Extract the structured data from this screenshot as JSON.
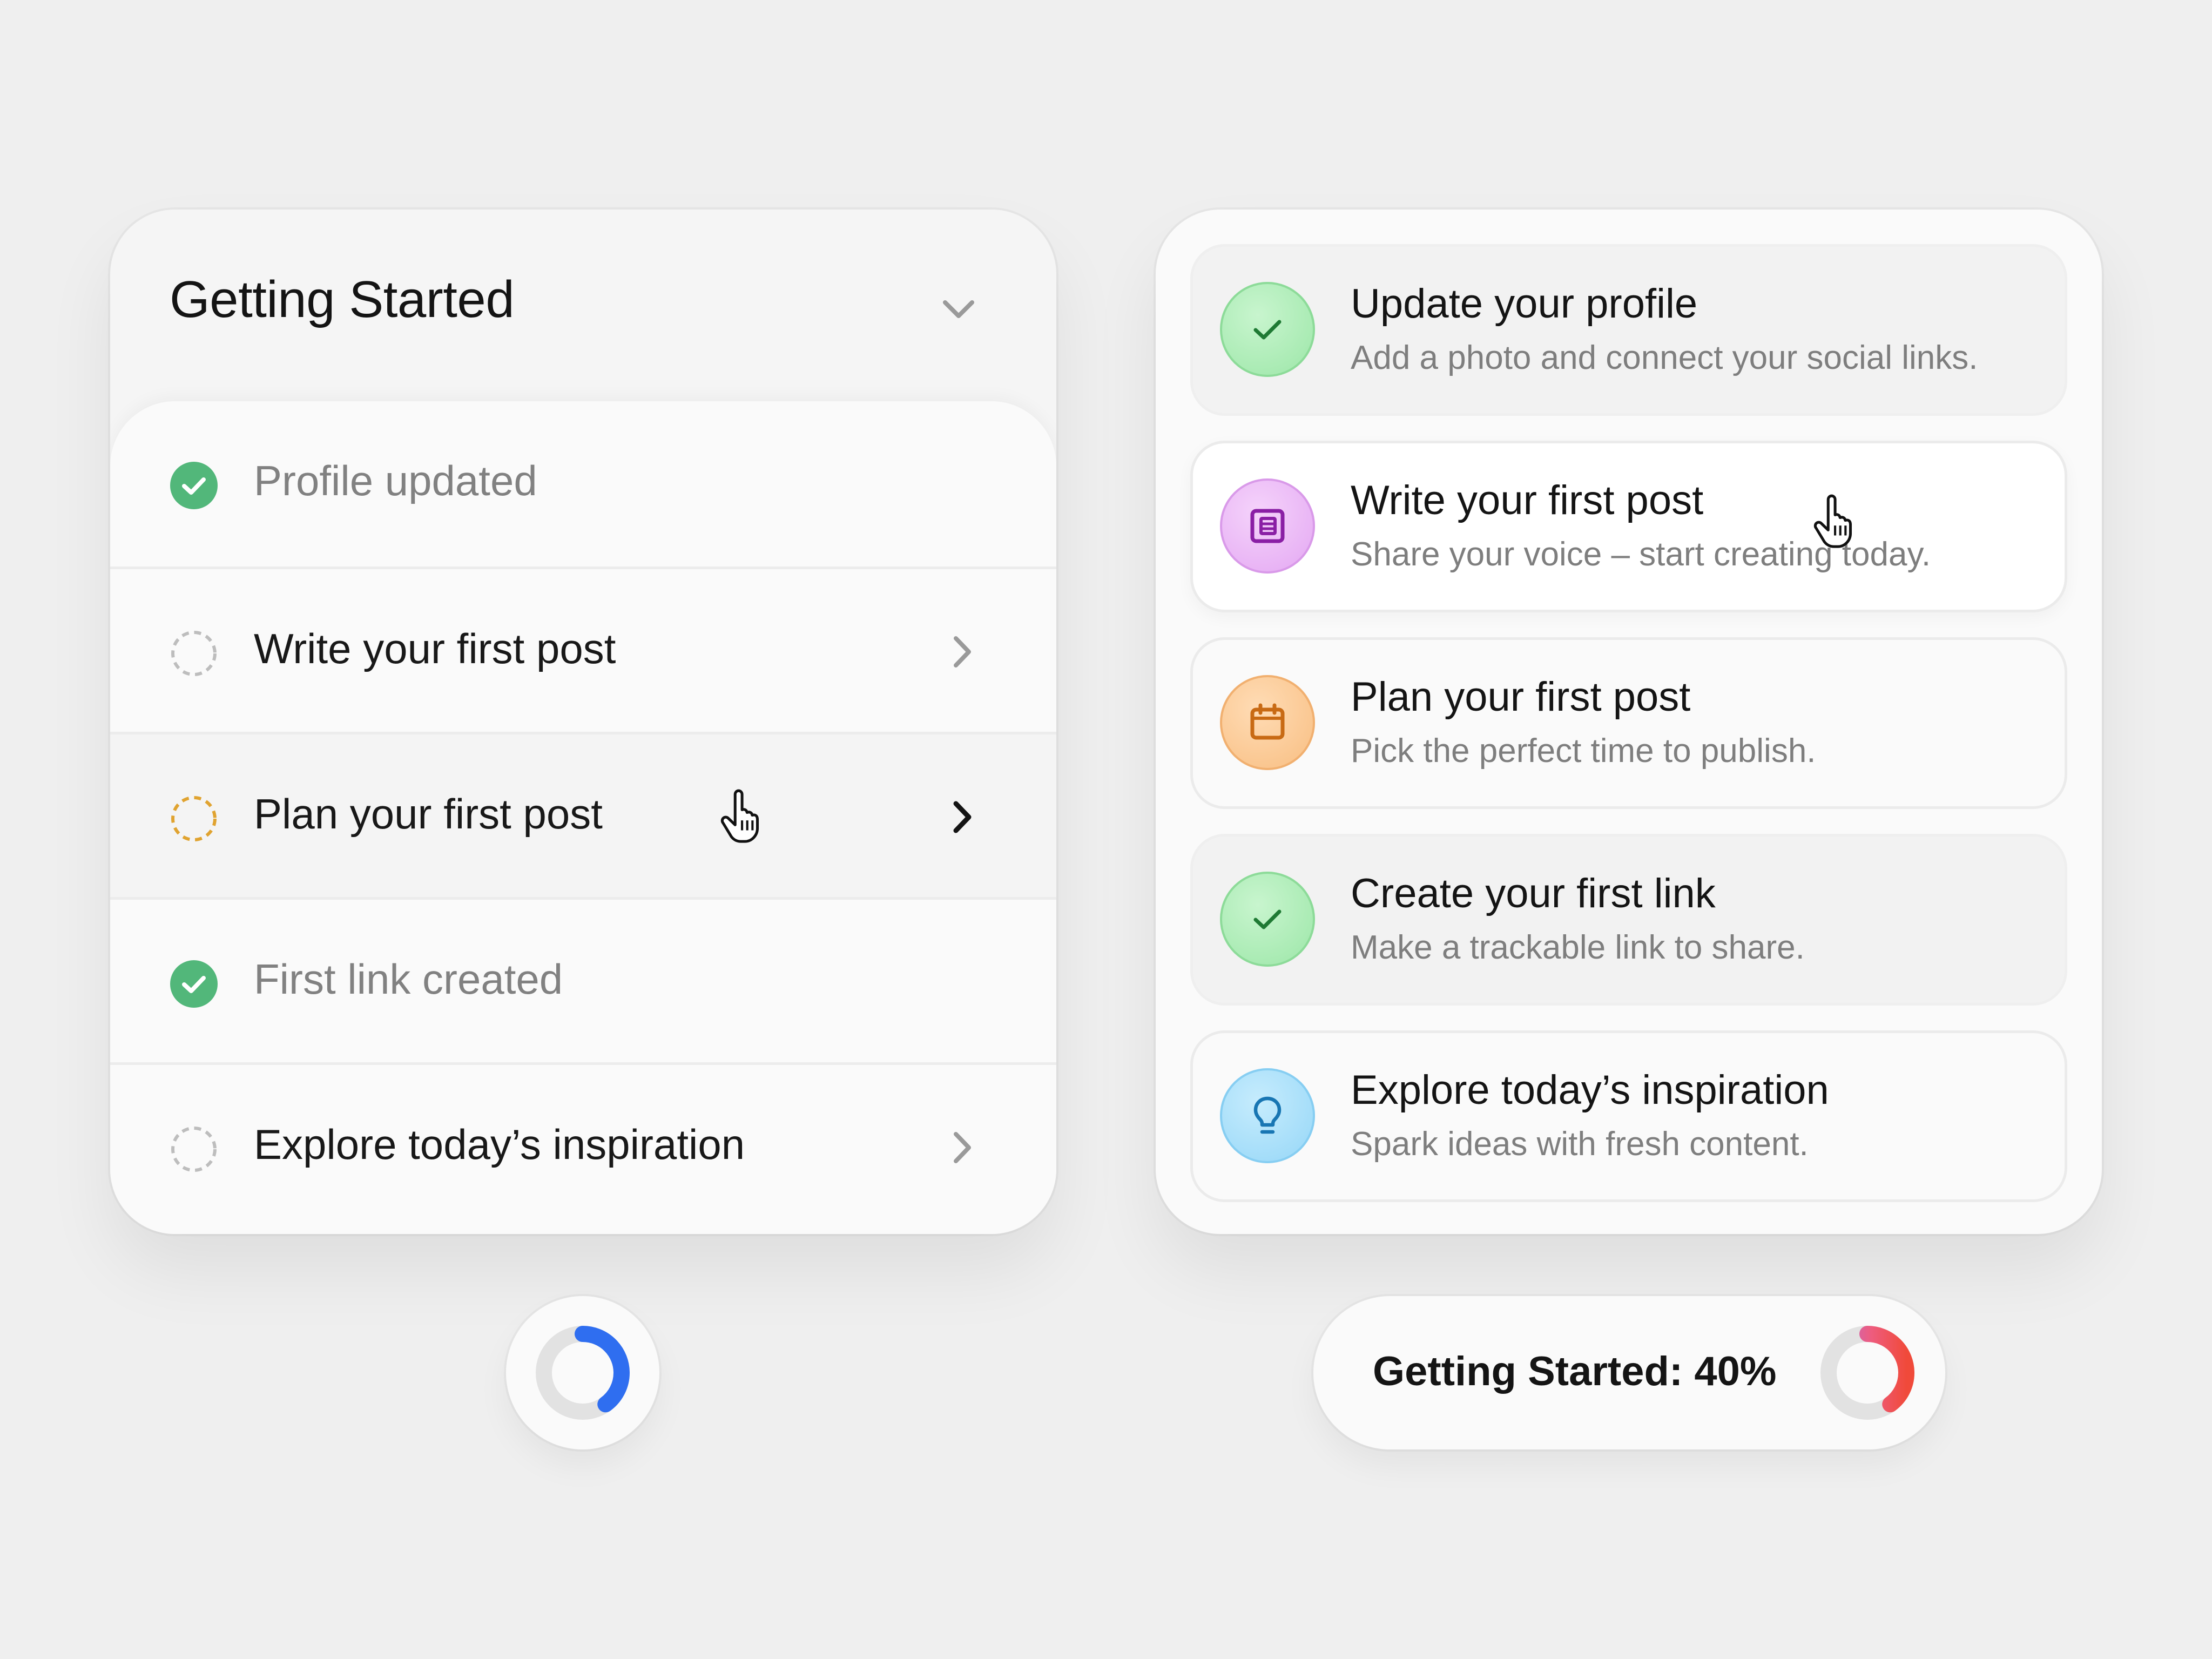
{
  "left_card": {
    "title": "Getting Started",
    "items": [
      {
        "label": "Profile updated",
        "status": "done"
      },
      {
        "label": "Write your first post",
        "status": "todo"
      },
      {
        "label": "Plan your first post",
        "status": "in-progress"
      },
      {
        "label": "First link created",
        "status": "done"
      },
      {
        "label": "Explore today’s inspiration",
        "status": "todo"
      }
    ],
    "progress_fraction": 0.4,
    "colors": {
      "done": "#52b77a",
      "in_progress": "#e0a330",
      "todo": "#b8b8b8",
      "ring": "#2f6ef0"
    }
  },
  "right_card": {
    "tasks": [
      {
        "title": "Update your profile",
        "subtitle": "Add a photo and connect your social links.",
        "icon": "check-icon",
        "color": "#1f7a34"
      },
      {
        "title": "Write your first post",
        "subtitle": "Share your voice – start creating today.",
        "icon": "newspaper-icon",
        "color": "#8a1fa5"
      },
      {
        "title": "Plan your first post",
        "subtitle": "Pick the perfect time to publish.",
        "icon": "calendar-icon",
        "color": "#c86a14"
      },
      {
        "title": "Create your first link",
        "subtitle": "Make a trackable link to share.",
        "icon": "check-icon",
        "color": "#1f7a34"
      },
      {
        "title": "Explore today’s inspiration",
        "subtitle": "Spark ideas with fresh content.",
        "icon": "lightbulb-icon",
        "color": "#1876b3"
      }
    ],
    "progress_label": "Getting Started: 40%",
    "progress_fraction": 0.4
  }
}
